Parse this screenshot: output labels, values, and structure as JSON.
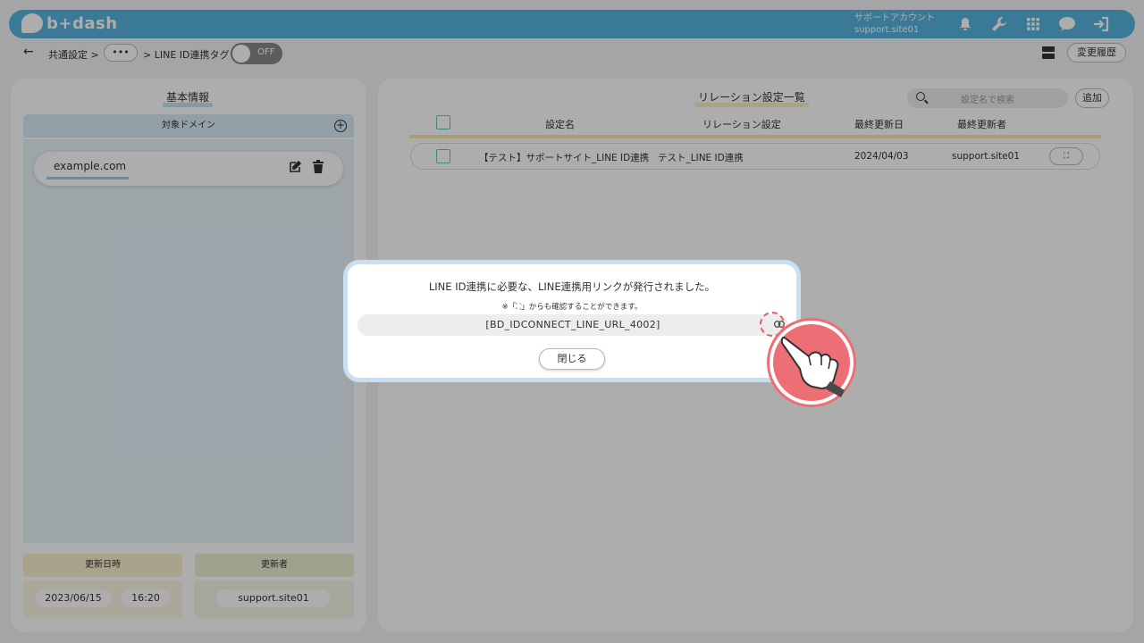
{
  "header": {
    "logo_text": "b+dash",
    "account_label": "サポートアカウント",
    "account_id": "support.site01",
    "icons": [
      "bell-icon",
      "wrench-icon",
      "grid-icon",
      "help-chat-icon",
      "logout-icon"
    ]
  },
  "subbar": {
    "back": "←",
    "crumb_root": "共通設定 >",
    "ellipsis": "•••",
    "crumb_current": "> LINE ID連携タグ",
    "toggle_label": "OFF",
    "history_label": "変更履歴"
  },
  "left": {
    "title": "基本情報",
    "domain_header": "対象ドメイン",
    "domain": "example.com",
    "updated_at_label": "更新日時",
    "updated_by_label": "更新者",
    "updated_date": "2023/06/15",
    "updated_time": "16:20",
    "updated_by": "support.site01"
  },
  "right": {
    "title": "リレーション設定一覧",
    "search_placeholder": "設定名で検索",
    "add_label": "追加",
    "columns": [
      "設定名",
      "リレーション設定",
      "最終更新日",
      "最終更新者"
    ],
    "rows": [
      {
        "name": "【テスト】サポートサイト_LINE ID連携",
        "relation": "テスト_LINE ID連携",
        "updated": "2024/04/03",
        "updater": "support.site01",
        "action": "⛶"
      }
    ]
  },
  "modal": {
    "message": "LINE ID連携に必要な、LINE連携用リンクが発行されました。",
    "note": "※「⛶」からも確認することができます。",
    "url": "[BD_IDCONNECT_LINE_URL_4002]",
    "close_label": "閉じる"
  },
  "colors": {
    "header_bg": "#56b4de",
    "accent_red": "#ec6f76",
    "checkbox": "#60c6c0",
    "yellow_line": "#f7e8a6"
  }
}
